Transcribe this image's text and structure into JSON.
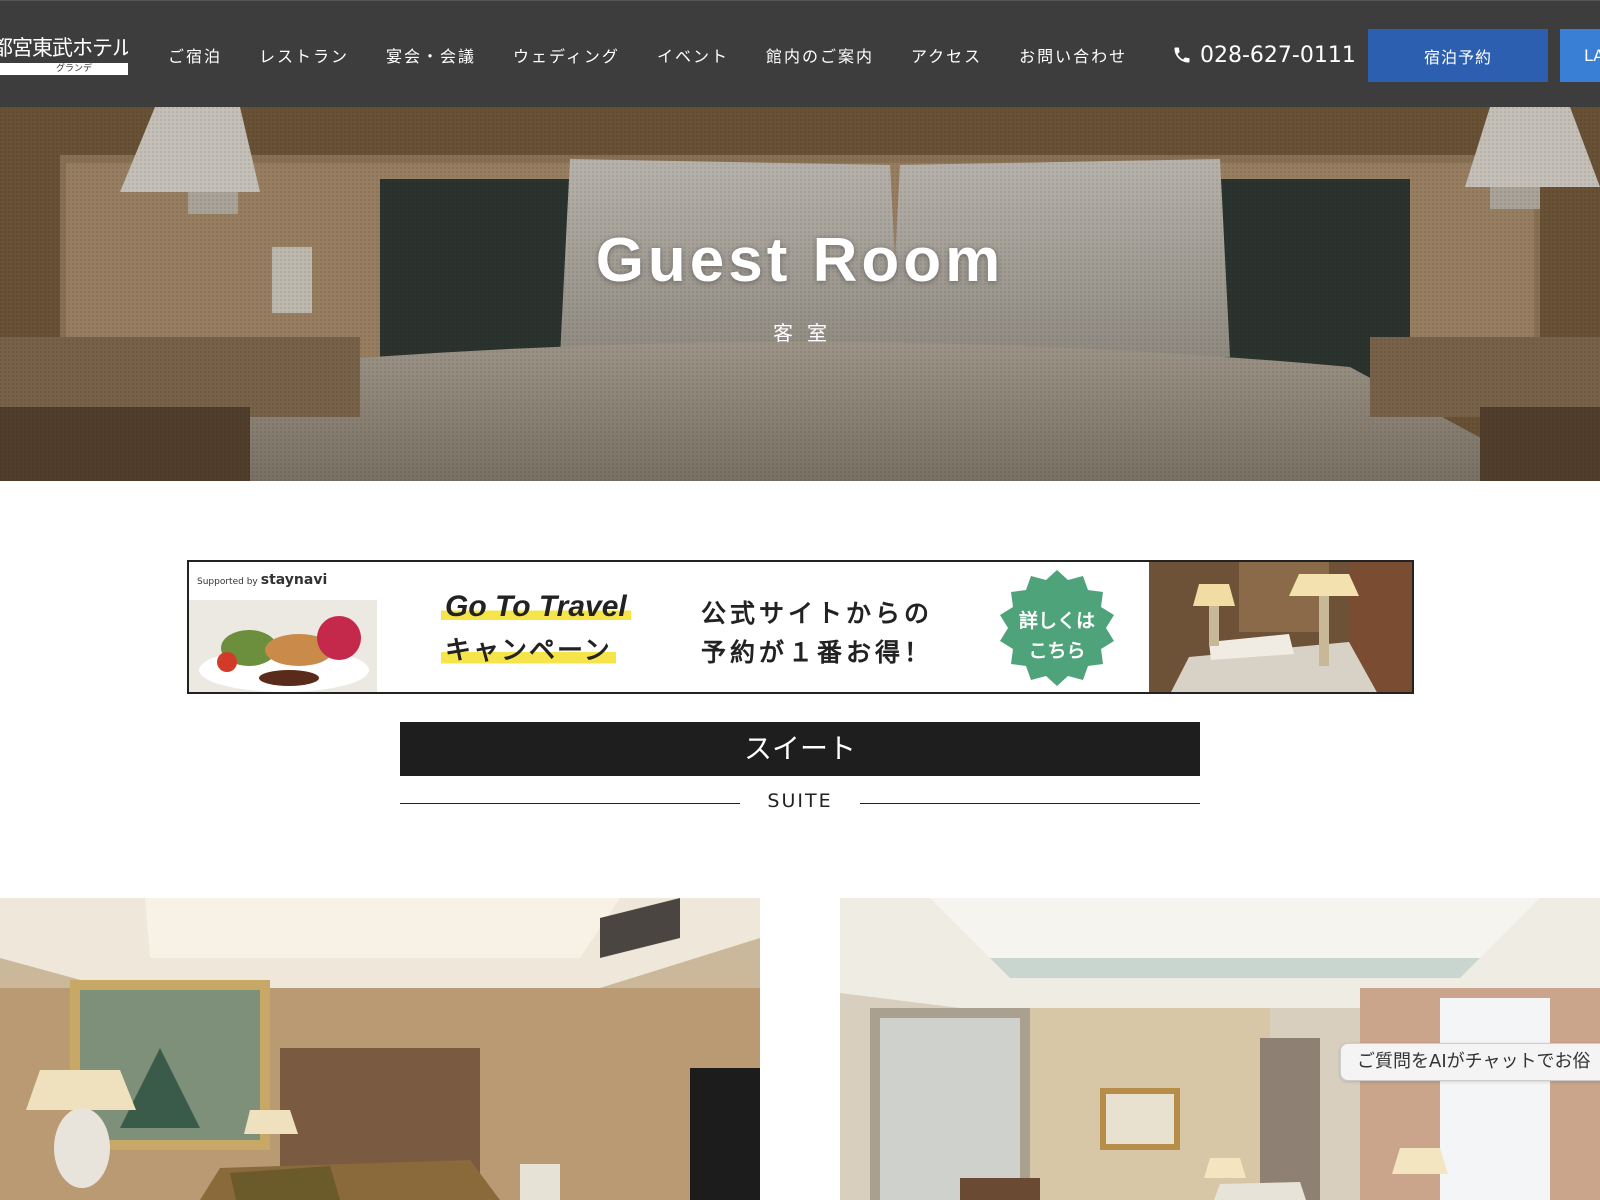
{
  "header": {
    "logo_main": "都宮東武ホテル",
    "logo_sub": "グランデ",
    "nav": [
      {
        "label": "ご宿泊"
      },
      {
        "label": "レストラン"
      },
      {
        "label": "宴会・会議"
      },
      {
        "label": "ウェディング"
      },
      {
        "label": "イベント"
      },
      {
        "label": "館内のご案内"
      },
      {
        "label": "アクセス"
      },
      {
        "label": "お問い合わせ"
      }
    ],
    "phone": "028-627-0111",
    "reserve_label": "宿泊予約",
    "lang_label": "LA"
  },
  "hero": {
    "title": "Guest Room",
    "subtitle": "客室"
  },
  "banner": {
    "supported_by": "Supported by",
    "brand": "staynavi",
    "goto_line1": "Go To Travel",
    "goto_line2": "キャンペーン",
    "copy_line1": "公式サイトからの",
    "copy_line2": "予約が１番お得！",
    "badge_line1": "詳しくは",
    "badge_line2": "こちら"
  },
  "section": {
    "title": "スイート",
    "subtitle": "SUITE"
  },
  "chat": {
    "label": "ご質問をAIがチャットでお俗"
  },
  "colors": {
    "header_bg": "#3d3d3d",
    "reserve_button": "#2d5fb0",
    "lang_button": "#3a7fd6",
    "section_bar": "#1e1e1e",
    "badge": "#4fa37a",
    "highlight": "#f6e54a"
  },
  "icons": {
    "phone": "phone-icon"
  }
}
